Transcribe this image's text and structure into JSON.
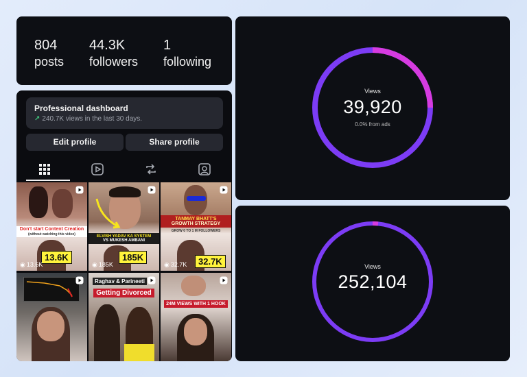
{
  "stats": {
    "posts": {
      "value": "804",
      "label": "posts"
    },
    "followers": {
      "value": "44.3K",
      "label": "followers"
    },
    "following": {
      "value": "1",
      "label": "following"
    }
  },
  "dashboard": {
    "title": "Professional dashboard",
    "subtitle": "240.7K views in the last 30 days."
  },
  "buttons": {
    "edit": "Edit profile",
    "share": "Share profile"
  },
  "tabs": [
    "grid-icon",
    "reels-icon",
    "reposts-icon",
    "tagged-icon"
  ],
  "posts": [
    {
      "caption": "Don't start Content Creation",
      "caption_sub": "(without watching this video)",
      "views_badge": "13.6K",
      "views": "13.6K"
    },
    {
      "caption": "ELVISH YADAV KA SYSTEM",
      "caption_sub": "VS MUKESH AMBANI",
      "views_badge": "185K",
      "views": "185K"
    },
    {
      "caption": "TANMAY BHATT'S",
      "caption_sub": "GROWTH STRATEGY",
      "caption_sub2": "GROW 0 TO 1 M FOLLOWERS",
      "views_badge": "32.7K",
      "views": "32.7K"
    },
    {
      "caption": ""
    },
    {
      "caption": "Raghav & Parineeti",
      "caption_sub": "Getting Divorced"
    },
    {
      "caption": "24M VIEWS WITH 1 HOOK"
    }
  ],
  "ring1": {
    "label": "Views",
    "value": "39,920",
    "sub": "0.0% from ads",
    "accent_fraction": 0.25
  },
  "ring2": {
    "label": "Views",
    "value": "252,104",
    "accent_fraction": 0.015
  },
  "colors": {
    "ring_purple": "#7c3cf5",
    "ring_magenta": "#d63be0",
    "badge_yellow": "#fff33c",
    "caption_red": "#e02424"
  }
}
